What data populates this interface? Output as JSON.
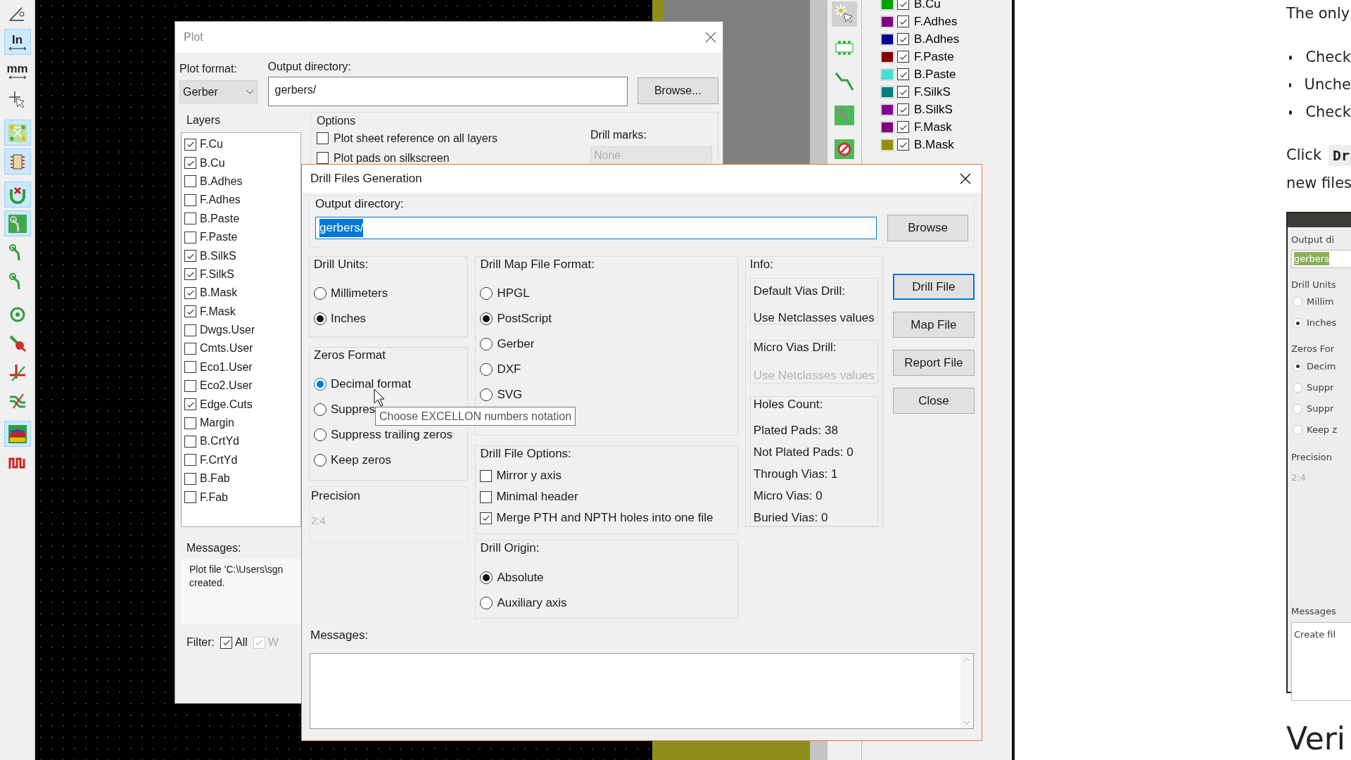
{
  "left_toolbar": [
    {
      "kind": "angle",
      "selected": false
    },
    {
      "kind": "text",
      "label": "In",
      "selected": true
    },
    {
      "kind": "text",
      "label": "mm",
      "selected": false
    },
    {
      "kind": "cursor",
      "selected": false
    },
    {
      "kind": "ratsnest",
      "selected": true
    },
    {
      "kind": "chip",
      "selected": true
    },
    {
      "kind": "magnet",
      "selected": true
    },
    {
      "kind": "track_filled",
      "selected": true
    },
    {
      "kind": "track",
      "selected": false
    },
    {
      "kind": "track",
      "selected": false
    },
    {
      "kind": "via",
      "selected": false
    },
    {
      "kind": "probe",
      "selected": false
    },
    {
      "kind": "measure",
      "selected": false
    },
    {
      "kind": "route",
      "selected": false
    },
    {
      "kind": "fill",
      "selected": true
    },
    {
      "kind": "tune",
      "selected": false
    }
  ],
  "right_toolbar": [
    {
      "kind": "select",
      "selected": true
    },
    {
      "kind": "footprint",
      "selected": false
    },
    {
      "kind": "track",
      "selected": false
    },
    {
      "kind": "route",
      "selected": false
    },
    {
      "kind": "drc",
      "selected": false
    }
  ],
  "layer_panel": [
    {
      "name": "B.Cu",
      "color": "#00a000",
      "checked": true
    },
    {
      "name": "F.Adhes",
      "color": "#800080",
      "checked": true
    },
    {
      "name": "B.Adhes",
      "color": "#000090",
      "checked": true
    },
    {
      "name": "F.Paste",
      "color": "#800000",
      "checked": true
    },
    {
      "name": "B.Paste",
      "color": "#40e0d0",
      "checked": true
    },
    {
      "name": "F.SilkS",
      "color": "#008080",
      "checked": true
    },
    {
      "name": "B.SilkS",
      "color": "#800090",
      "checked": true
    },
    {
      "name": "F.Mask",
      "color": "#800080",
      "checked": true
    },
    {
      "name": "B.Mask",
      "color": "#909000",
      "checked": true
    }
  ],
  "plot_dialog": {
    "title": "Plot",
    "plot_format_label": "Plot format:",
    "plot_format": "Gerber",
    "output_label": "Output directory:",
    "output_value": "gerbers/",
    "browse": "Browse...",
    "layers_label": "Layers",
    "layers": [
      {
        "name": "F.Cu",
        "checked": true
      },
      {
        "name": "B.Cu",
        "checked": true
      },
      {
        "name": "B.Adhes",
        "checked": false
      },
      {
        "name": "F.Adhes",
        "checked": false
      },
      {
        "name": "B.Paste",
        "checked": false
      },
      {
        "name": "F.Paste",
        "checked": false
      },
      {
        "name": "B.SilkS",
        "checked": true
      },
      {
        "name": "F.SilkS",
        "checked": true
      },
      {
        "name": "B.Mask",
        "checked": true
      },
      {
        "name": "F.Mask",
        "checked": true
      },
      {
        "name": "Dwgs.User",
        "checked": false
      },
      {
        "name": "Cmts.User",
        "checked": false
      },
      {
        "name": "Eco1.User",
        "checked": false
      },
      {
        "name": "Eco2.User",
        "checked": false
      },
      {
        "name": "Edge.Cuts",
        "checked": true
      },
      {
        "name": "Margin",
        "checked": false
      },
      {
        "name": "B.CrtYd",
        "checked": false
      },
      {
        "name": "F.CrtYd",
        "checked": false
      },
      {
        "name": "B.Fab",
        "checked": false
      },
      {
        "name": "F.Fab",
        "checked": false
      }
    ],
    "options_label": "Options",
    "options": [
      {
        "label": "Plot sheet reference on all layers",
        "checked": false
      },
      {
        "label": "Plot pads on silkscreen",
        "checked": false
      }
    ],
    "drill_marks_label": "Drill marks:",
    "drill_marks": "None",
    "messages_label": "Messages:",
    "messages": [
      "Plot file 'C:\\Users\\sgn",
      "created."
    ],
    "filter_label": "Filter:",
    "filters": [
      {
        "label": "All",
        "checked": true,
        "disabled": false
      },
      {
        "label": "W",
        "checked": true,
        "disabled": true
      }
    ]
  },
  "drill_dialog": {
    "title": "Drill Files Generation",
    "output_label": "Output directory:",
    "output_value": "gerbers/",
    "browse": "Browse",
    "drill_units": {
      "label": "Drill Units:",
      "options": [
        {
          "label": "Millimeters",
          "selected": false
        },
        {
          "label": "Inches",
          "selected": true
        }
      ]
    },
    "zeros_format": {
      "label": "Zeros Format",
      "options": [
        {
          "label": "Decimal format",
          "selected": true,
          "hovered": true
        },
        {
          "label": "Suppres",
          "selected": false,
          "hovered": false
        },
        {
          "label": "Suppress trailing zeros",
          "selected": false,
          "hovered": false
        },
        {
          "label": "Keep zeros",
          "selected": false,
          "hovered": false
        }
      ]
    },
    "precision": {
      "label": "Precision",
      "value": "2:4"
    },
    "map_format": {
      "label": "Drill Map File Format:",
      "options": [
        {
          "label": "HPGL",
          "selected": false
        },
        {
          "label": "PostScript",
          "selected": true
        },
        {
          "label": "Gerber",
          "selected": false
        },
        {
          "label": "DXF",
          "selected": false
        },
        {
          "label": "SVG",
          "selected": false
        }
      ]
    },
    "file_options": {
      "label": "Drill File Options:",
      "options": [
        {
          "label": "Mirror y axis",
          "checked": false
        },
        {
          "label": "Minimal header",
          "checked": false
        },
        {
          "label": "Merge PTH and NPTH holes into one file",
          "checked": true
        }
      ]
    },
    "origin": {
      "label": "Drill Origin:",
      "options": [
        {
          "label": "Absolute",
          "selected": true
        },
        {
          "label": "Auxiliary axis",
          "selected": false
        }
      ]
    },
    "info": {
      "label": "Info:",
      "default_vias_label": "Default Vias Drill:",
      "default_vias": "Use Netclasses values",
      "micro_vias_label": "Micro Vias Drill:",
      "micro_vias": "Use Netclasses values",
      "micro_vias_disabled": true,
      "holes_label": "Holes Count:",
      "holes": [
        "Plated Pads: 38",
        "Not Plated Pads: 0",
        "Through Vias: 1",
        "Micro Vias: 0",
        "Buried Vias: 0"
      ]
    },
    "buttons": [
      {
        "label": "Drill File",
        "focused": true
      },
      {
        "label": "Map File",
        "focused": false
      },
      {
        "label": "Report File",
        "focused": false
      },
      {
        "label": "Close",
        "focused": false
      }
    ],
    "messages_label": "Messages:",
    "tooltip": "Choose EXCELLON numbers notation"
  },
  "web_page": {
    "intro": "The only",
    "bullets": [
      "Check",
      "Unche",
      "Check"
    ],
    "click_text": "Click",
    "click_code": "Dr",
    "next_line": "new files",
    "screenshot": {
      "output_label": "Output di",
      "output_value": "gerbers",
      "units_label": "Drill Units",
      "units": [
        {
          "label": "Millim",
          "selected": false
        },
        {
          "label": "Inches",
          "selected": true
        }
      ],
      "zeros_label": "Zeros For",
      "zeros": [
        {
          "label": "Decim",
          "selected": true
        },
        {
          "label": "Suppr",
          "selected": false
        },
        {
          "label": "Suppr",
          "selected": false
        },
        {
          "label": "Keep z",
          "selected": false
        }
      ],
      "precision_label": "Precision",
      "precision": "2:4",
      "messages_label": "Messages",
      "messages": "Create fil"
    },
    "heading": "Veri"
  }
}
